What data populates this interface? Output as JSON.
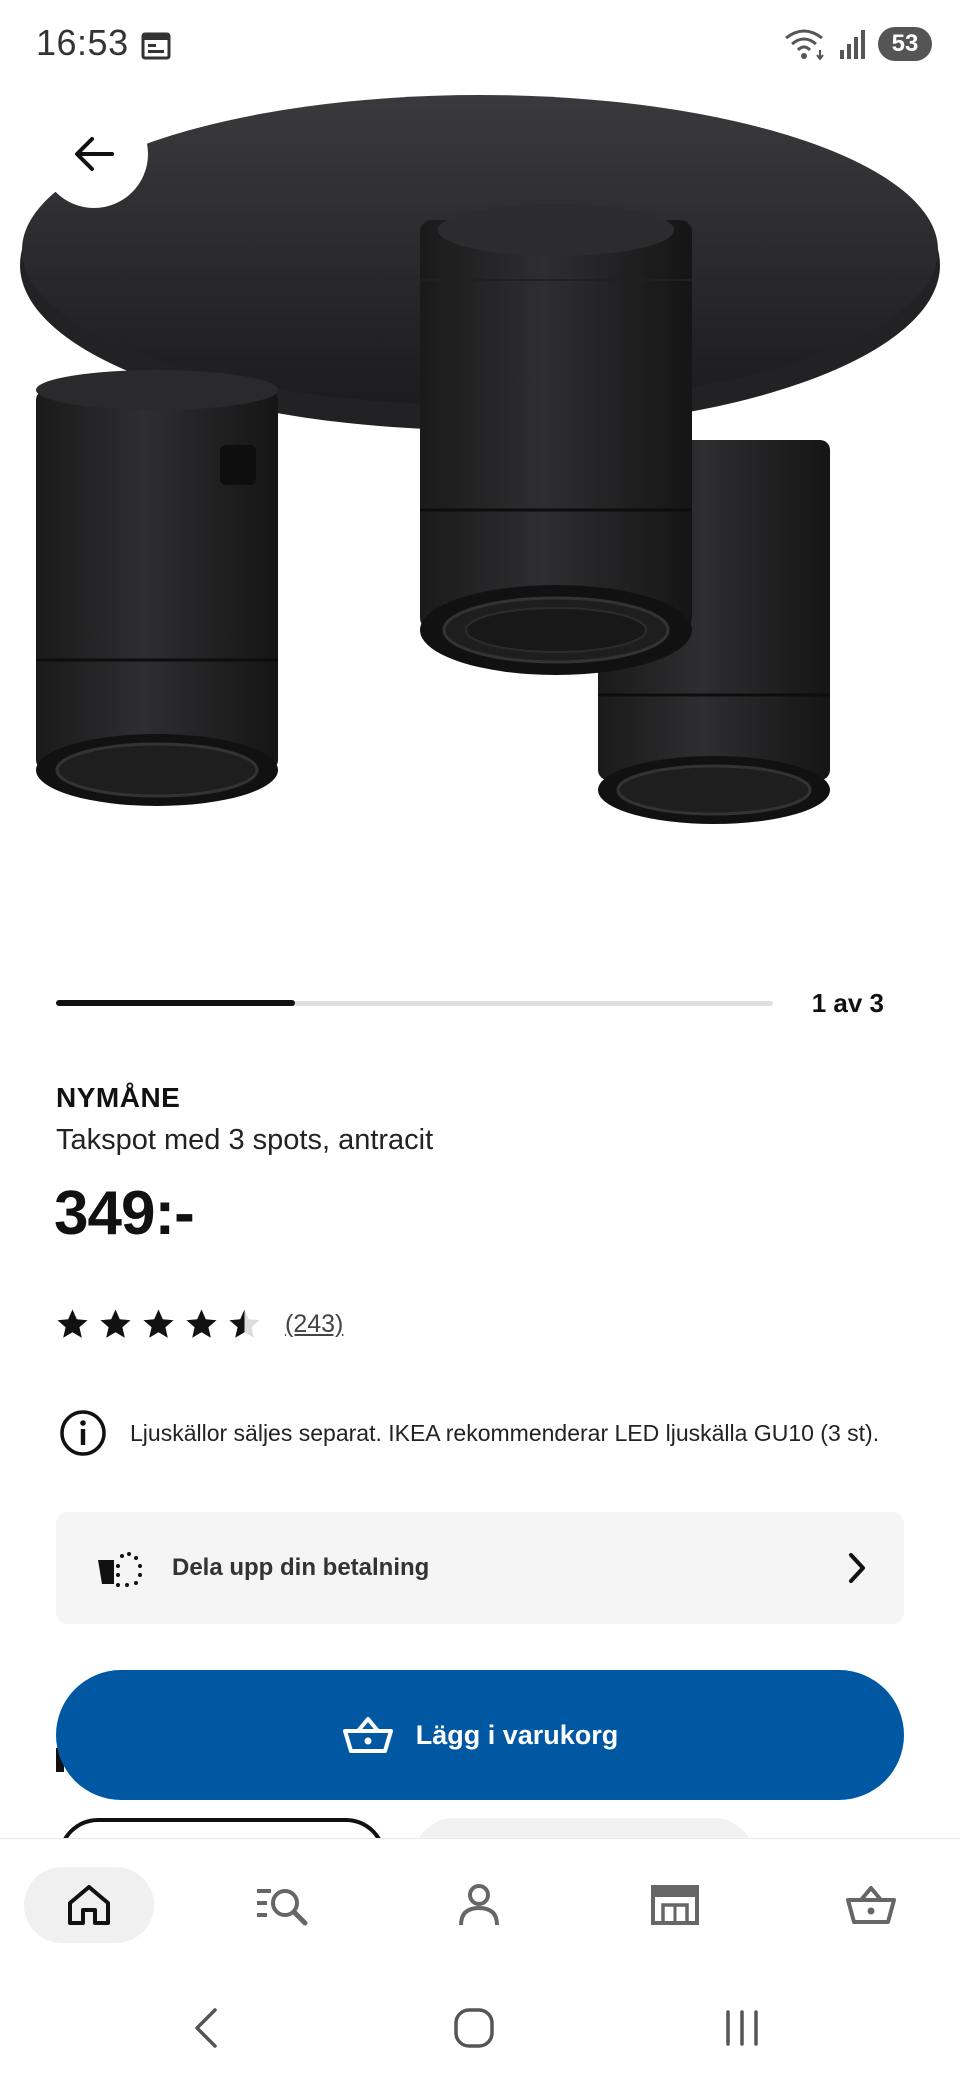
{
  "status_bar": {
    "time": "16:53",
    "battery": "53",
    "icons": [
      "calendar-icon",
      "wifi-icon",
      "signal-icon",
      "battery-icon"
    ]
  },
  "gallery": {
    "page_indicator": "1 av 3",
    "progress": 0.333
  },
  "product": {
    "brand": "NYMÅNE",
    "description": "Takspot med 3 spots, antracit",
    "price": "349:-",
    "rating": 4.5,
    "rating_max": 5,
    "review_count": "(243)"
  },
  "notice": {
    "text": "Ljuskällor säljes separat. IKEA rekommenderar LED ljuskälla GU10 (3 st)."
  },
  "installment": {
    "label": "Dela upp din betalning"
  },
  "cta": {
    "add_to_cart": "Lägg i varukorg"
  },
  "bottom_nav": {
    "items": [
      "home-icon",
      "search-list-icon",
      "account-icon",
      "store-icon",
      "cart-icon"
    ],
    "active": "home-icon"
  },
  "system_nav": [
    "back-icon",
    "home-circle-icon",
    "recents-icon"
  ],
  "colors": {
    "primary": "#0058a3",
    "text": "#111111",
    "surface": "#f5f5f5"
  }
}
